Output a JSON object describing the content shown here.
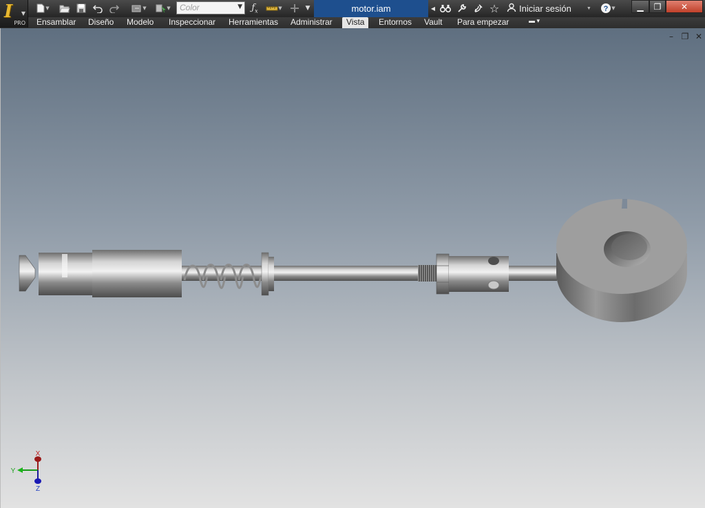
{
  "app": {
    "badge": "PRO",
    "document_title": "motor.iam"
  },
  "quick_access": {
    "color_placeholder": "Color",
    "icons": [
      "new-icon",
      "open-icon",
      "save-icon",
      "undo-icon",
      "redo-icon",
      "update-icon",
      "select-icon",
      "color-combo",
      "function-icon",
      "measure-icon",
      "plus-icon",
      "customize-icon"
    ]
  },
  "info_center": {
    "icons": [
      "binoculars-icon",
      "wrench-icon",
      "satellite-icon",
      "star-icon",
      "user-icon",
      "help-icon"
    ],
    "signin_label": "Iniciar sesión"
  },
  "ribbon": {
    "tabs": [
      "Ensamblar",
      "Diseño",
      "Modelo",
      "Inspeccionar",
      "Herramientas",
      "Administrar",
      "Vista",
      "Entornos",
      "Vault",
      "Para empezar"
    ],
    "active_tab": "Vista"
  },
  "triad": {
    "x_label": "X",
    "y_label": "Y",
    "z_label": "Z"
  },
  "colors": {
    "accent_blue": "#1e4f8e",
    "close_red": "#c0402a"
  }
}
